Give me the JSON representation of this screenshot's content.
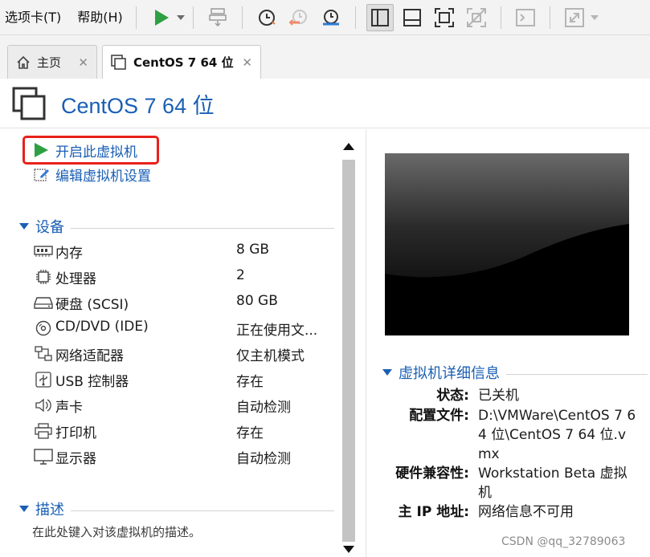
{
  "menu": {
    "tabs_label": "选项卡(T)",
    "help_label": "帮助(H)"
  },
  "tabs": [
    {
      "label": "主页"
    },
    {
      "label": "CentOS 7 64 位"
    }
  ],
  "vm": {
    "title": "CentOS 7 64 位"
  },
  "actions": {
    "power_on": "开启此虚拟机",
    "edit_settings": "编辑虚拟机设置"
  },
  "devices": {
    "header": "设备",
    "items": [
      {
        "name": "内存",
        "value": "8 GB",
        "icon": "memory-icon"
      },
      {
        "name": "处理器",
        "value": "2",
        "icon": "cpu-icon"
      },
      {
        "name": "硬盘 (SCSI)",
        "value": "80 GB",
        "icon": "hard-disk-icon"
      },
      {
        "name": "CD/DVD (IDE)",
        "value": "正在使用文...",
        "icon": "cd-dvd-icon"
      },
      {
        "name": "网络适配器",
        "value": "仅主机模式",
        "icon": "network-adapter-icon"
      },
      {
        "name": "USB 控制器",
        "value": "存在",
        "icon": "usb-icon"
      },
      {
        "name": "声卡",
        "value": "自动检测",
        "icon": "sound-card-icon"
      },
      {
        "name": "打印机",
        "value": "存在",
        "icon": "printer-icon"
      },
      {
        "name": "显示器",
        "value": "自动检测",
        "icon": "display-icon"
      }
    ]
  },
  "description": {
    "header": "描述",
    "placeholder": "在此处键入对该虚拟机的描述。"
  },
  "details": {
    "header": "虚拟机详细信息",
    "state_label": "状态:",
    "state_value": "已关机",
    "config_label": "配置文件:",
    "config_value": "D:\\VMWare\\CentOS 7 64 位\\CentOS 7 64 位.vmx",
    "compat_label": "硬件兼容性:",
    "compat_value": "Workstation Beta 虚拟机",
    "ip_label": "主 IP 地址:",
    "ip_value": "网络信息不可用"
  },
  "watermark": "CSDN @qq_32789063",
  "colors": {
    "accent": "#1a5fb4",
    "play": "#2ea043",
    "highlight": "#e8211a"
  }
}
